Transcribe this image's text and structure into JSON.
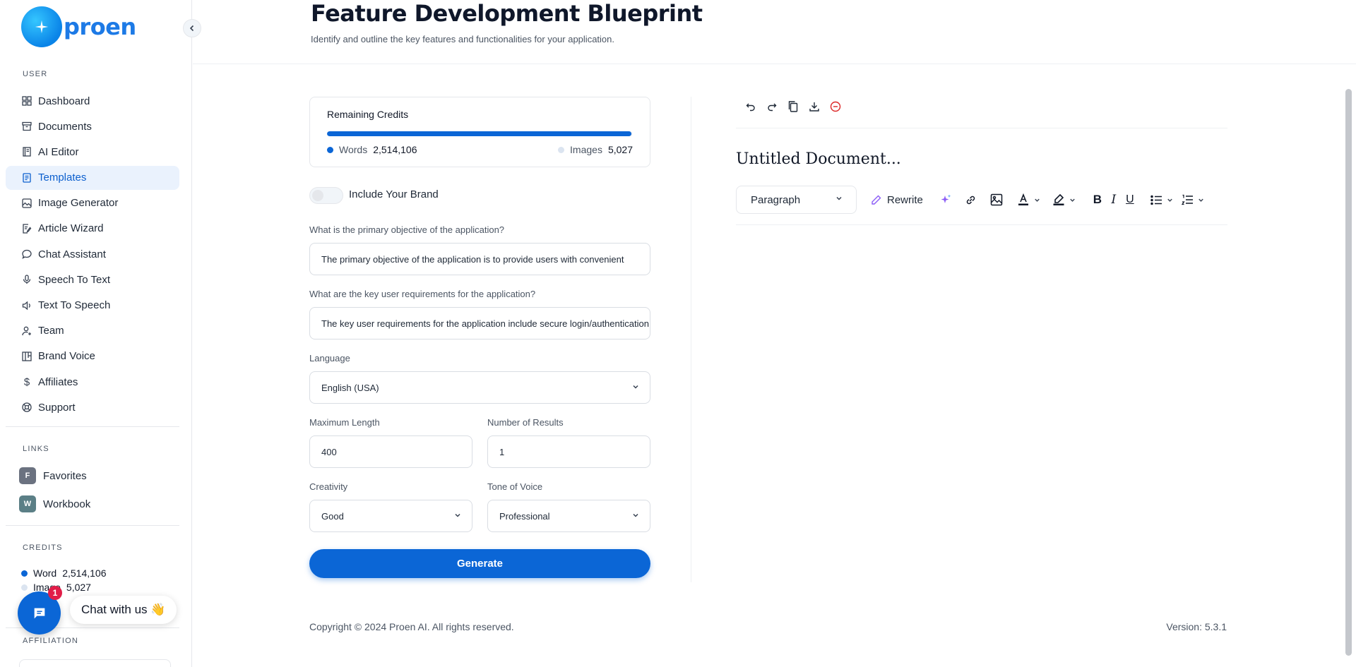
{
  "brand": {
    "name": "proen"
  },
  "sidebar": {
    "user_label": "USER",
    "items": [
      {
        "label": "Dashboard",
        "icon": "grid-icon"
      },
      {
        "label": "Documents",
        "icon": "archive-icon"
      },
      {
        "label": "AI Editor",
        "icon": "notebook-icon"
      },
      {
        "label": "Templates",
        "icon": "file-text-icon",
        "active": true
      },
      {
        "label": "Image Generator",
        "icon": "image-icon"
      },
      {
        "label": "Article Wizard",
        "icon": "file-edit-icon"
      },
      {
        "label": "Chat Assistant",
        "icon": "chat-icon"
      },
      {
        "label": "Speech To Text",
        "icon": "mic-icon"
      },
      {
        "label": "Text To Speech",
        "icon": "speaker-icon"
      },
      {
        "label": "Team",
        "icon": "user-plus-icon"
      },
      {
        "label": "Brand Voice",
        "icon": "layout-icon"
      },
      {
        "label": "Affiliates",
        "icon": "dollar-icon"
      },
      {
        "label": "Support",
        "icon": "lifebuoy-icon"
      }
    ],
    "links_label": "LINKS",
    "links": [
      {
        "badge": "F",
        "label": "Favorites",
        "color": "#6b7280"
      },
      {
        "badge": "W",
        "label": "Workbook",
        "color": "#5b7f86"
      }
    ],
    "credits_label": "CREDITS",
    "credits": {
      "word_label": "Word",
      "word_value": "2,514,106",
      "image_label": "Image",
      "image_value": "5,027"
    },
    "affiliation_label": "AFFILIATION"
  },
  "chat_widget": {
    "badge_count": "1",
    "text": "Chat with us 👋"
  },
  "header": {
    "title": "Feature Development Blueprint",
    "subtitle": "Identify and outline the key features and functionalities for your application."
  },
  "form": {
    "credits_card": {
      "title": "Remaining Credits",
      "words_label": "Words",
      "words_value": "2,514,106",
      "images_label": "Images",
      "images_value": "5,027",
      "progress_fraction": 0.998
    },
    "brand_toggle": {
      "label": "Include Your Brand",
      "on": false
    },
    "q1": {
      "label": "What is the primary objective of the application?",
      "value": "The primary objective of the application is to provide users with convenient"
    },
    "q2": {
      "label": "What are the key user requirements for the application?",
      "value": "The key user requirements for the application include secure login/authentication"
    },
    "language": {
      "label": "Language",
      "value": "English (USA)"
    },
    "max_length": {
      "label": "Maximum Length",
      "value": "400"
    },
    "num_results": {
      "label": "Number of Results",
      "value": "1"
    },
    "creativity": {
      "label": "Creativity",
      "value": "Good"
    },
    "tone": {
      "label": "Tone of Voice",
      "value": "Professional"
    },
    "generate_label": "Generate"
  },
  "editor": {
    "doc_title": "Untitled Document...",
    "block_type": "Paragraph",
    "rewrite_label": "Rewrite"
  },
  "footer": {
    "copyright": "Copyright © 2024 Proen AI. All rights reserved.",
    "version": "Version: 5.3.1"
  },
  "colors": {
    "accent": "#0b66d6",
    "active_bg": "#eaf2fd",
    "danger": "#dc2626",
    "ai_purple": "#8b5cf6"
  }
}
